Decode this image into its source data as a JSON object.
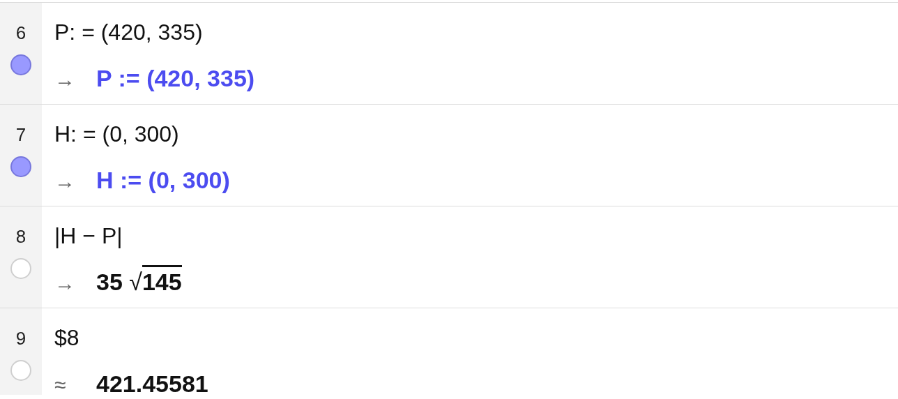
{
  "rows": [
    {
      "number": "6",
      "visible": true,
      "input": "P: = (420, 335)",
      "output": {
        "kind": "text",
        "symbol": "→",
        "text": "P := (420, 335)"
      }
    },
    {
      "number": "7",
      "visible": true,
      "input": "H: = (0, 300)",
      "output": {
        "kind": "text",
        "symbol": "→",
        "text": "H := (0, 300)"
      }
    },
    {
      "number": "8",
      "visible": false,
      "input": "|H − P|",
      "output": {
        "kind": "sqrt",
        "symbol": "→",
        "coefficient": "35",
        "radical": "√",
        "radicand": "145"
      }
    },
    {
      "number": "9",
      "visible": false,
      "input": "$8",
      "output": {
        "kind": "text",
        "symbol": "≈",
        "text": "421.45581"
      }
    }
  ]
}
